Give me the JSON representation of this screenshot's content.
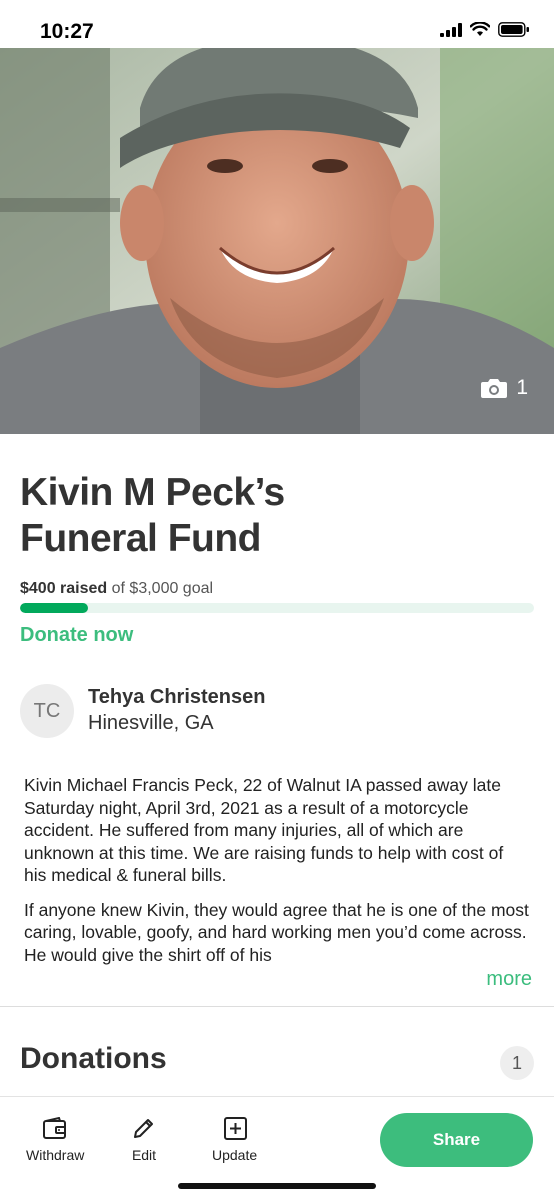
{
  "status": {
    "time": "10:27"
  },
  "hero": {
    "photo_count": "1",
    "camera_icon": "camera-icon"
  },
  "campaign": {
    "title_line1": "Kivin M Peck’s",
    "title_line2": "Funeral Fund",
    "raised_amount": "$400 raised",
    "goal_text": " of $3,000 goal",
    "progress_fraction": 0.133,
    "donate_label": "Donate now"
  },
  "organizer": {
    "initials": "TC",
    "name": "Tehya Christensen",
    "location": "Hinesville, GA"
  },
  "story": {
    "paragraph1": "Kivin Michael Francis Peck, 22 of Walnut IA passed away late Saturday night, April 3rd, 2021 as a result of a motorcycle accident. He suffered from many injuries, all of which are unknown at this time. We are raising funds to help with cost of his medical & funeral bills.",
    "paragraph2": "If anyone knew Kivin, they would agree that he is one of the most caring, lovable, goofy, and hard working men you’d come across. He would give the shirt off of his",
    "more_label": "more"
  },
  "donations": {
    "title": "Donations",
    "count": "1"
  },
  "bottom_bar": {
    "withdraw_label": "Withdraw",
    "edit_label": "Edit",
    "update_label": "Update",
    "share_label": "Share"
  },
  "colors": {
    "accent": "#3cbd7e",
    "progress": "#02a95c",
    "progress_track": "#e8f5ef"
  }
}
